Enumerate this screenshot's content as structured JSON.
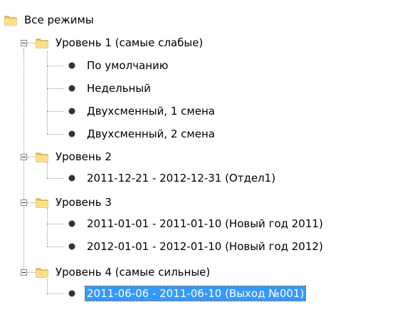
{
  "tree": {
    "root": {
      "label": "Все режимы"
    },
    "groups": [
      {
        "label": "Уровень 1 (самые слабые)",
        "children": [
          {
            "label": "По умолчанию"
          },
          {
            "label": "Недельный"
          },
          {
            "label": "Двухсменный, 1 смена"
          },
          {
            "label": "Двухсменный, 2 смена"
          }
        ]
      },
      {
        "label": "Уровень 2",
        "children": [
          {
            "label": "2011-12-21 - 2012-12-31 (Отдел1)"
          }
        ]
      },
      {
        "label": "Уровень 3",
        "children": [
          {
            "label": "2011-01-01 - 2011-01-10 (Новый год 2011)"
          },
          {
            "label": "2012-01-01 - 2012-01-10 (Новый год 2012)"
          }
        ]
      },
      {
        "label": "Уровень 4 (самые сильные)",
        "children": [
          {
            "label": "2011-06-06 - 2011-06-10 (Выход №001)",
            "selected": true
          }
        ]
      }
    ]
  },
  "icons": {
    "folder": "folder-icon",
    "leaf": "schedule-bullet-icon",
    "expander": "collapse-icon"
  },
  "colors": {
    "selection": "#3399ff",
    "folder": "#f4c94a"
  }
}
